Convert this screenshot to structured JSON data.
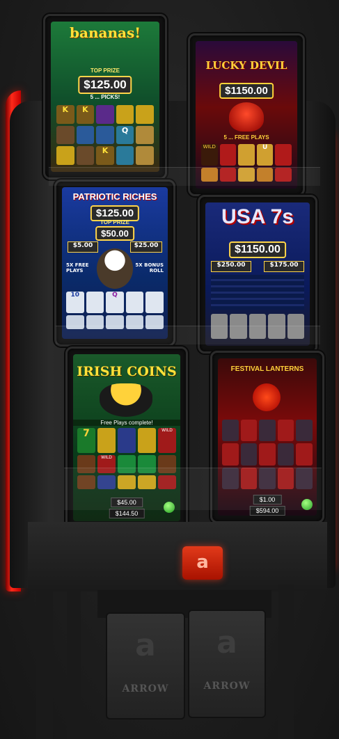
{
  "screens": [
    {
      "title": "bananas!",
      "top_label": "TOP PRIZE",
      "prize": "$125.00",
      "sub": "5 ... PICKS!",
      "symbols": [
        "K",
        "K",
        "",
        "",
        "",
        "",
        "",
        "",
        "Q",
        "",
        "",
        "",
        "K",
        ""
      ]
    },
    {
      "title": "LUCKY DEVIL",
      "prize": "$1150.00",
      "sub": "5 ... FREE PLAYS",
      "symbols": [
        "WILD",
        "",
        "",
        "U",
        "",
        "",
        "",
        "",
        "",
        "",
        "",
        "",
        ""
      ]
    },
    {
      "title": "PATRIOTIC RICHES",
      "prize": "$125.00",
      "top_label": "TOP PRIZE",
      "prize2": "$50.00",
      "left_amount": "$5.00",
      "right_amount": "$25.00",
      "left_note": "5X FREE PLAYS",
      "right_note": "5X BONUS ROLL",
      "symbols": [
        "10",
        "Q",
        "",
        "",
        "",
        "",
        "",
        ""
      ]
    },
    {
      "title": "USA 7s",
      "prize": "$1150.00",
      "left_amount": "$250.00",
      "right_amount": "$175.00"
    },
    {
      "title": "IRISH COINS",
      "banner": "Free Plays complete!",
      "credit": "$45.00",
      "win": "$144.50",
      "symbols": [
        "7",
        "",
        "",
        "",
        "WILD",
        "",
        "WILD",
        "",
        "",
        "",
        "",
        "",
        "",
        ""
      ]
    },
    {
      "title": "FESTIVAL LANTERNS",
      "credit": "$1.00",
      "win": "$594.00"
    }
  ],
  "brand": {
    "logo_letter": "a",
    "pedal_text": "ARROW"
  },
  "colors": {
    "accent_red": "#ff2a1a",
    "cabinet": "#1b1b1b"
  }
}
